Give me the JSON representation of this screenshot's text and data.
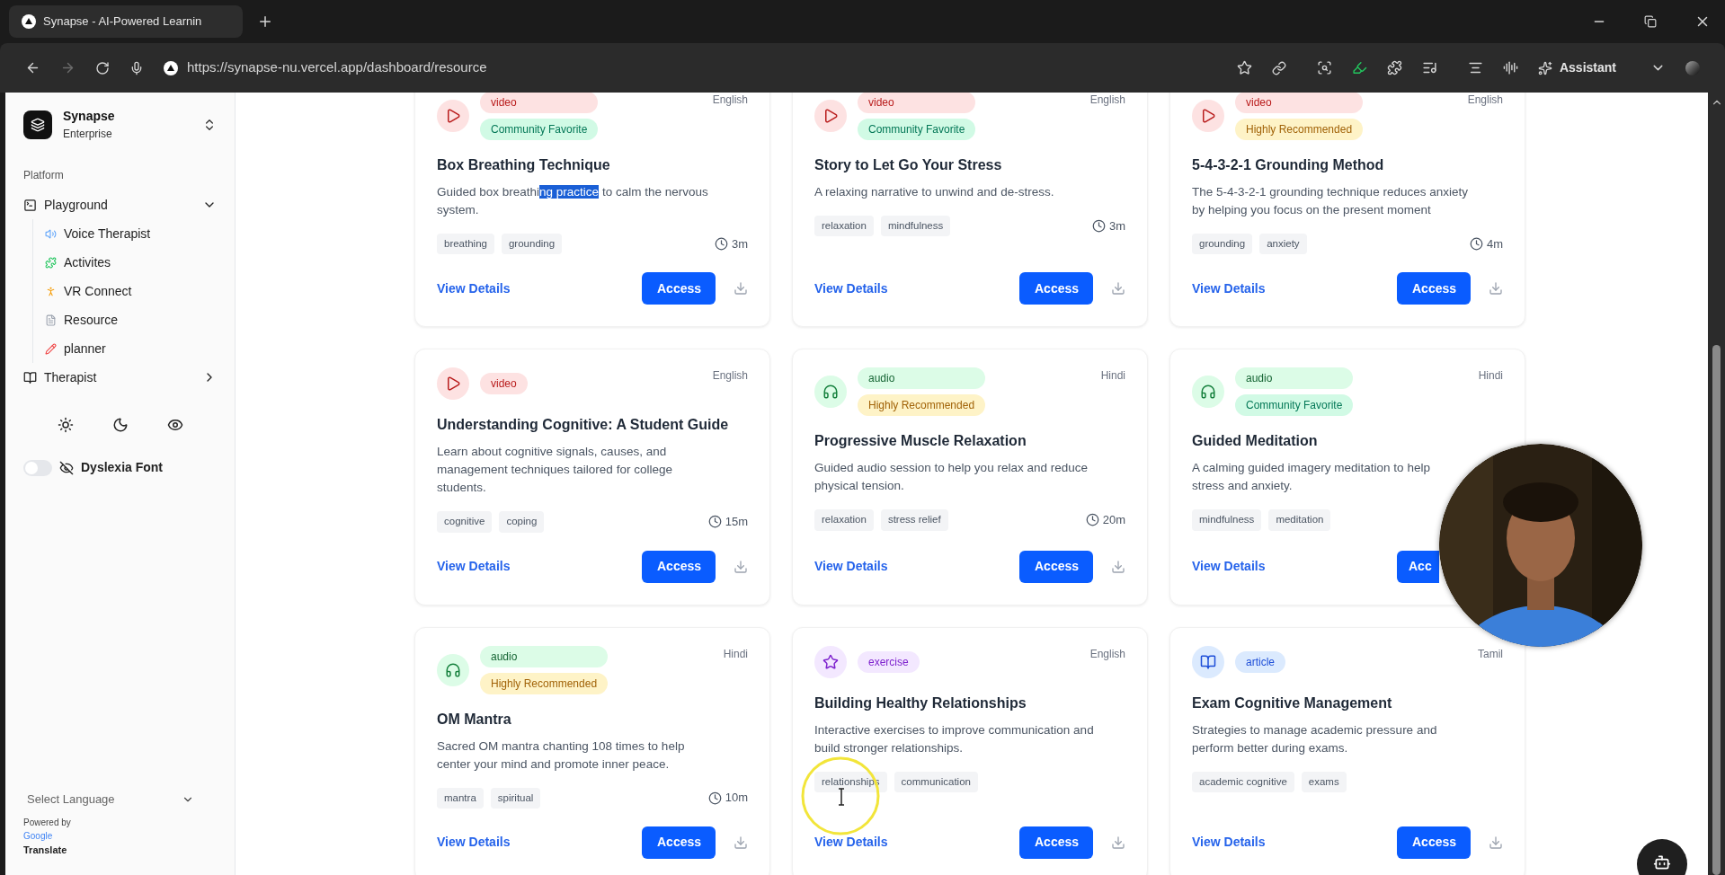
{
  "browser": {
    "tab_title": "Synapse - AI-Powered Learnin",
    "url": "https://synapse-nu.vercel.app/dashboard/resource",
    "assistant_label": "Assistant"
  },
  "sidebar": {
    "org_name": "Synapse",
    "org_plan": "Enterprise",
    "section_label": "Platform",
    "nav": [
      {
        "label": "Playground",
        "expanded": true,
        "children": [
          {
            "label": "Voice Therapist"
          },
          {
            "label": "Activites"
          },
          {
            "label": "VR Connect"
          },
          {
            "label": "Resource"
          },
          {
            "label": "planner"
          }
        ]
      },
      {
        "label": "Therapist",
        "expanded": false
      }
    ],
    "dyslexia_font": {
      "label": "Dyslexia Font",
      "on": false
    },
    "language": {
      "placeholder": "Select Language"
    },
    "powered_by": "Powered by",
    "google": "Google",
    "translate": "Translate"
  },
  "resources": [
    {
      "kind": "video",
      "type_label": "video",
      "recommendation": {
        "kind": "favorite",
        "label": "Community Favorite"
      },
      "language": "English",
      "title": "Box Breathing Technique",
      "description": [
        {
          "text": "Guided box breathi",
          "selected": false
        },
        {
          "text": "ng practice",
          "selected": true
        },
        {
          "text": " to calm the nervous\nsystem.",
          "selected": false
        }
      ],
      "tags": [
        "breathing",
        "grounding"
      ],
      "duration": "3m",
      "view_label": "View Details",
      "access_label": "Access",
      "download": true
    },
    {
      "kind": "video",
      "type_label": "video",
      "recommendation": {
        "kind": "favorite",
        "label": "Community Favorite"
      },
      "language": "English",
      "title": "Story to Let Go Your Stress",
      "description": [
        {
          "text": "A relaxing narrative to unwind and de-stress.",
          "selected": false
        }
      ],
      "tags": [
        "relaxation",
        "mindfulness"
      ],
      "duration": "3m",
      "view_label": "View Details",
      "access_label": "Access",
      "download": true
    },
    {
      "kind": "video",
      "type_label": "video",
      "recommendation": {
        "kind": "recommended",
        "label": "Highly Recommended"
      },
      "language": "English",
      "title": "5-4-3-2-1 Grounding Method",
      "description": [
        {
          "text": "The 5-4-3-2-1 grounding technique reduces anxiety\nby helping you focus on the present moment",
          "selected": false
        }
      ],
      "tags": [
        "grounding",
        "anxiety"
      ],
      "duration": "4m",
      "view_label": "View Details",
      "access_label": "Access",
      "download": true
    },
    {
      "kind": "video",
      "type_label": "video",
      "language": "English",
      "title": "Understanding Cognitive: A Student Guide",
      "description": [
        {
          "text": "Learn about cognitive signals, causes, and\nmanagement techniques tailored for college\nstudents.",
          "selected": false
        }
      ],
      "tags": [
        "cognitive",
        "coping"
      ],
      "duration": "15m",
      "view_label": "View Details",
      "access_label": "Access",
      "download": true
    },
    {
      "kind": "audio",
      "type_label": "audio",
      "recommendation": {
        "kind": "recommended",
        "label": "Highly Recommended"
      },
      "language": "Hindi",
      "title": "Progressive Muscle Relaxation",
      "description": [
        {
          "text": "Guided audio session to help you relax and reduce\nphysical tension.",
          "selected": false
        }
      ],
      "tags": [
        "relaxation",
        "stress relief"
      ],
      "duration": "20m",
      "view_label": "View Details",
      "access_label": "Access",
      "download": true
    },
    {
      "kind": "audio",
      "type_label": "audio",
      "recommendation": {
        "kind": "favorite",
        "label": "Community Favorite"
      },
      "language": "Hindi",
      "title": "Guided Meditation",
      "description": [
        {
          "text": "A calming guided imagery meditation to help\nstress and anxiety.",
          "selected": false
        }
      ],
      "tags": [
        "mindfulness",
        "meditation"
      ],
      "view_label": "View Details",
      "access_label": "Acc",
      "download": false
    },
    {
      "kind": "audio",
      "type_label": "audio",
      "recommendation": {
        "kind": "recommended",
        "label": "Highly Recommended"
      },
      "language": "Hindi",
      "title": "OM Mantra",
      "description": [
        {
          "text": "Sacred OM mantra chanting 108 times to help\ncenter your mind and promote inner peace.",
          "selected": false
        }
      ],
      "tags": [
        "mantra",
        "spiritual"
      ],
      "duration": "10m",
      "view_label": "View Details",
      "access_label": "Access",
      "download": true
    },
    {
      "kind": "exercise",
      "type_label": "exercise",
      "language": "English",
      "title": "Building Healthy Relationships",
      "description": [
        {
          "text": "Interactive exercises to improve communication and\nbuild stronger relationships.",
          "selected": false
        }
      ],
      "tags": [
        "relationships",
        "communication"
      ],
      "view_label": "View Details",
      "access_label": "Access",
      "download": true
    },
    {
      "kind": "article",
      "type_label": "article",
      "language": "Tamil",
      "title": "Exam Cognitive Management",
      "description": [
        {
          "text": "Strategies to manage academic pressure and\nperform better during exams.",
          "selected": false
        }
      ],
      "tags": [
        "academic cognitive",
        "exams"
      ],
      "view_label": "View Details",
      "access_label": "Access",
      "download": true
    }
  ]
}
